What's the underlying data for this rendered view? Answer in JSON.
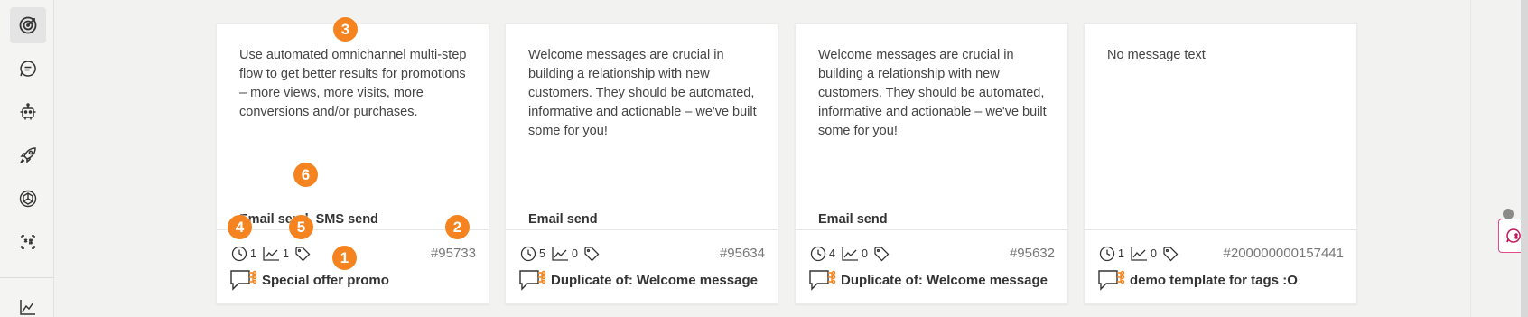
{
  "sidebar": {
    "items": [
      {
        "icon": "target-icon"
      },
      {
        "icon": "chat-bubble-icon"
      },
      {
        "icon": "robot-icon"
      },
      {
        "icon": "rocket-icon"
      },
      {
        "icon": "openai-icon"
      },
      {
        "icon": "template-tag-icon"
      },
      {
        "icon": "analytics-chart-icon"
      }
    ]
  },
  "cards": [
    {
      "description": "Use automated omnichannel multi-step flow to get better results for promotions – more views, more visits, more conversions and/or purchases.",
      "type": "Email send, SMS send",
      "time_count": "1",
      "chart_count": "1",
      "id": "#95733",
      "title": "Special offer promo"
    },
    {
      "description": "Welcome messages are crucial in building a relationship with new customers. They should be automated, informative and actionable – we've built some for you!",
      "type": "Email send",
      "time_count": "5",
      "chart_count": "0",
      "id": "#95634",
      "title": "Duplicate of: Welcome message"
    },
    {
      "description": "Welcome messages are crucial in building a relationship with new customers. They should be automated, informative and actionable – we've built some for you!",
      "type": "Email send",
      "time_count": "4",
      "chart_count": "0",
      "id": "#95632",
      "title": "Duplicate of: Welcome message"
    },
    {
      "description": "No message text",
      "type": "",
      "time_count": "1",
      "chart_count": "0",
      "id": "#200000000157441",
      "title": "demo template for tags :O"
    }
  ],
  "markers": [
    "1",
    "2",
    "3",
    "4",
    "5",
    "6"
  ],
  "colors": {
    "accent": "#f5831f",
    "chat_widget_border": "#e24a8b",
    "background": "#f2f2f1"
  }
}
